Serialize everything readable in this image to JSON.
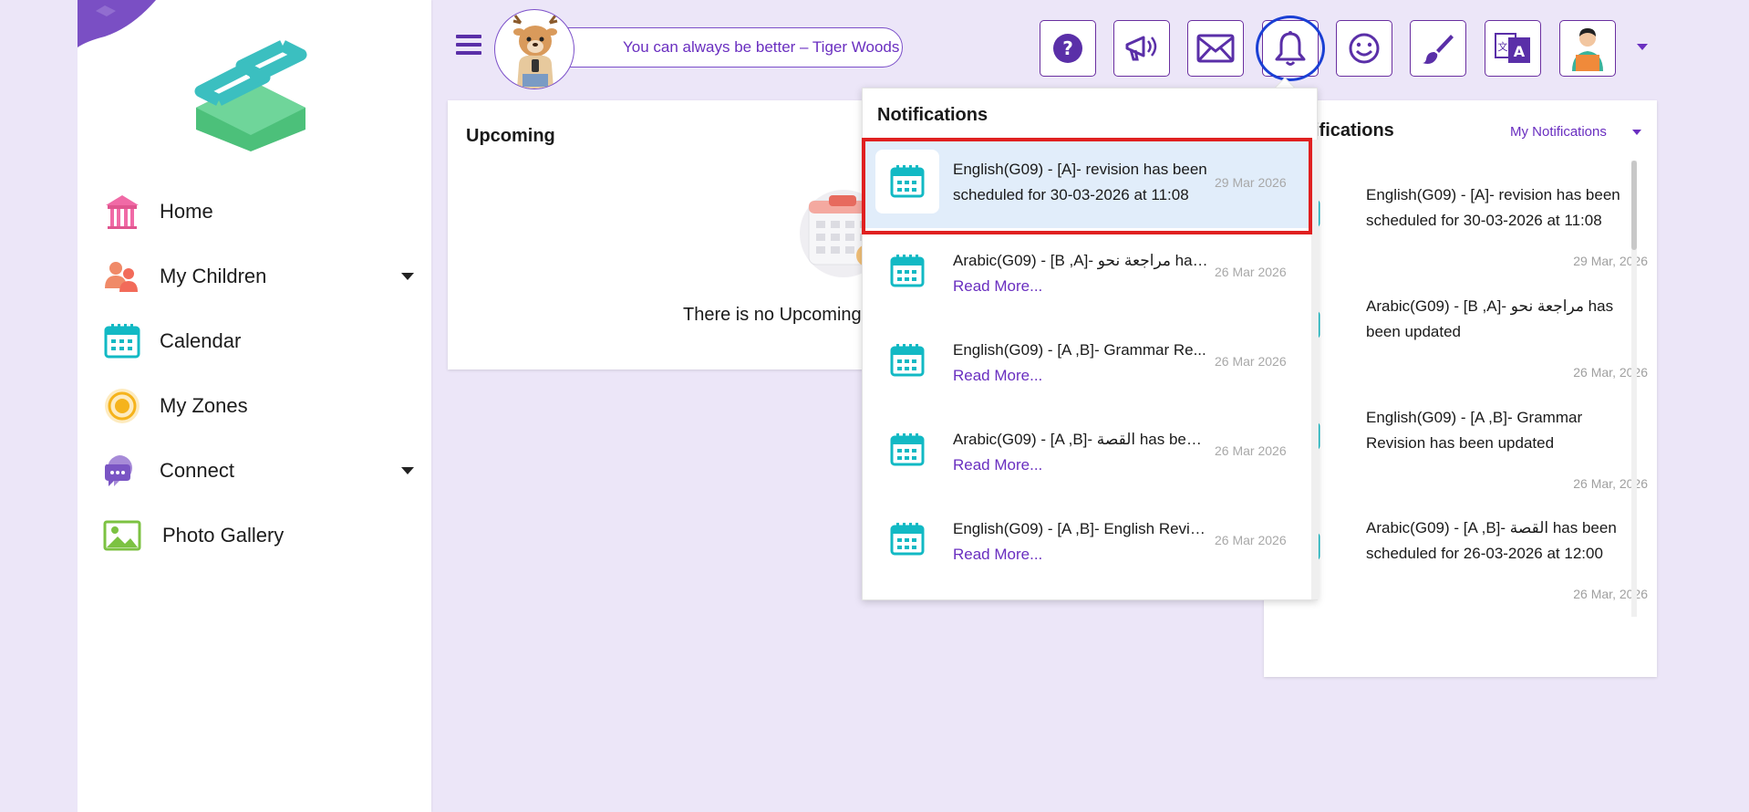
{
  "sidebar": {
    "items": [
      {
        "label": "Home",
        "icon": "home-icon",
        "has_dropdown": false
      },
      {
        "label": "My Children",
        "icon": "children-icon",
        "has_dropdown": true
      },
      {
        "label": "Calendar",
        "icon": "calendar-icon",
        "has_dropdown": false
      },
      {
        "label": "My Zones",
        "icon": "zones-icon",
        "has_dropdown": false
      },
      {
        "label": "Connect",
        "icon": "connect-icon",
        "has_dropdown": true
      },
      {
        "label": "Photo Gallery",
        "icon": "photo-gallery-icon",
        "has_dropdown": false
      }
    ]
  },
  "header": {
    "quote": "You can always be better – Tiger Woods",
    "toolbar": [
      "help-icon",
      "announcement-icon",
      "mail-icon",
      "bell-icon",
      "smiley-icon",
      "brush-icon",
      "language-icon",
      "profile-avatar"
    ]
  },
  "upcoming": {
    "title": "Upcoming",
    "empty_text": "There is no Upcoming E"
  },
  "notifications_dropdown": {
    "title": "Notifications",
    "read_more": "Read More...",
    "items": [
      {
        "text": "English(G09) - [A]- revision has been scheduled for 30-03-2026 at 11:08",
        "date": "29 Mar 2026",
        "expanded": true
      },
      {
        "text": "Arabic(G09) - [B ,A]- مراجعة نحو has ...",
        "date": "26 Mar 2026",
        "expanded": false
      },
      {
        "text": "English(G09) - [A ,B]- Grammar Re...",
        "date": "26 Mar 2026",
        "expanded": false
      },
      {
        "text": "Arabic(G09) - [A ,B]- القصة has been...",
        "date": "26 Mar 2026",
        "expanded": false
      },
      {
        "text": "English(G09) - [A ,B]- English Revis...",
        "date": "26 Mar 2026",
        "expanded": false
      }
    ]
  },
  "notifications_panel": {
    "title": "ifications",
    "filter": "My Notifications",
    "items": [
      {
        "text": "English(G09) - [A]- revision has been scheduled for 30-03-2026 at 11:08",
        "date": "29 Mar, 2026"
      },
      {
        "text": "Arabic(G09) - [B ,A]- مراجعة نحو has been updated",
        "date": "26 Mar, 2026"
      },
      {
        "text": "English(G09) - [A ,B]- Grammar Revision has been updated",
        "date": "26 Mar, 2026"
      },
      {
        "text": "Arabic(G09) - [A ,B]- القصة has been scheduled for 26-03-2026 at 12:00",
        "date": "26 Mar, 2026"
      }
    ]
  },
  "colors": {
    "background": "#ece6f8",
    "accent": "#6a2fc0",
    "highlight": "#e02020",
    "bell_ring": "#1a3fd4",
    "teal": "#12b9c4"
  }
}
